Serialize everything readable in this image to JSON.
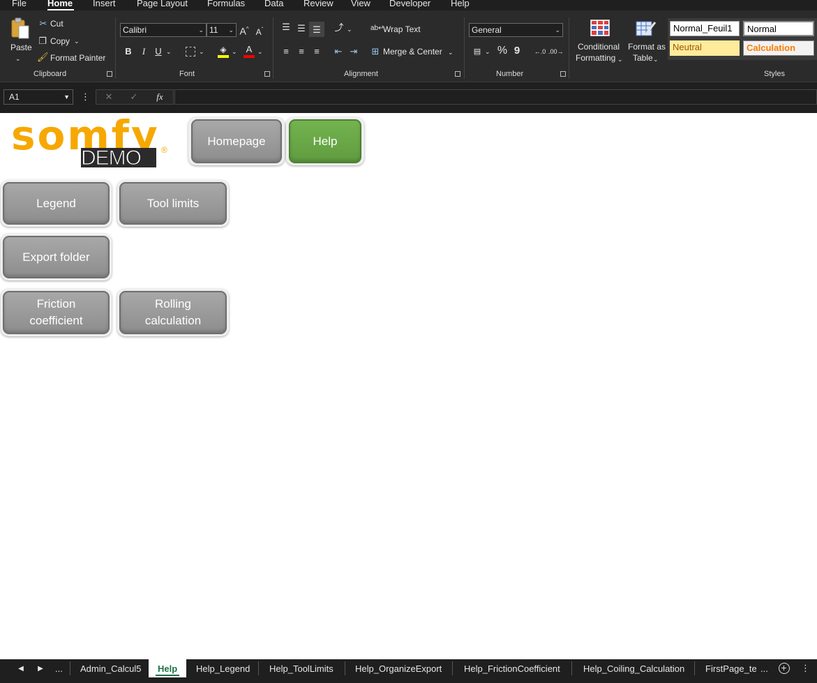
{
  "menu": {
    "tabs": [
      "File",
      "Home",
      "Insert",
      "Page Layout",
      "Formulas",
      "Data",
      "Review",
      "View",
      "Developer",
      "Help"
    ],
    "active": "Home"
  },
  "ribbon": {
    "clipboard": {
      "label": "Clipboard",
      "paste": "Paste",
      "cut": "Cut",
      "copy": "Copy",
      "format_painter": "Format Painter"
    },
    "font": {
      "label": "Font",
      "font_name": "Calibri",
      "font_size": "11",
      "bold": "B",
      "italic": "I",
      "underline": "U",
      "font_color": "#ff0000",
      "highlight_color": "#ffff00"
    },
    "alignment": {
      "label": "Alignment",
      "wrap_text": "Wrap Text",
      "merge_center": "Merge & Center"
    },
    "number": {
      "label": "Number",
      "format": "General",
      "percent": "%",
      "comma": "9"
    },
    "styles": {
      "label": "Styles",
      "conditional_formatting_line1": "Conditional",
      "conditional_formatting_line2": "Formatting",
      "format_as_table_line1": "Format as",
      "format_as_table_line2": "Table",
      "cells": [
        {
          "name": "Normal_Feuil1",
          "bg": "#ffffff",
          "color": "#000000"
        },
        {
          "name": "Normal",
          "bg": "#ffffff",
          "color": "#000000"
        },
        {
          "name": "Neutral",
          "bg": "#ffeb9c",
          "color": "#9c5700"
        },
        {
          "name": "Calculation",
          "bg": "#f2f2f2",
          "color": "#fa7d00"
        }
      ]
    }
  },
  "formula_bar": {
    "name_box": "A1",
    "cancel": "✕",
    "enter": "✓",
    "fx": "fx",
    "value": ""
  },
  "sheet": {
    "logo_text": "somfy",
    "logo_subtext": "DEMO",
    "logo_mark": "®",
    "logo_color": "#f6a800",
    "buttons": {
      "homepage": "Homepage",
      "help": "Help",
      "legend": "Legend",
      "tool_limits": "Tool limits",
      "export_folder": "Export folder",
      "friction_line1": "Friction",
      "friction_line2": "coefficient",
      "rolling_line1": "Rolling",
      "rolling_line2": "calculation"
    }
  },
  "sheet_tabs": {
    "more_left": "...",
    "tabs": [
      "Admin_Calcul5",
      "Help",
      "Help_Legend",
      "Help_ToolLimits",
      "Help_OrganizeExport",
      "Help_FrictionCoefficient",
      "Help_Coiling_Calculation",
      "FirstPage_ter"
    ],
    "active": "Help",
    "more_right": "...",
    "add": "+"
  }
}
